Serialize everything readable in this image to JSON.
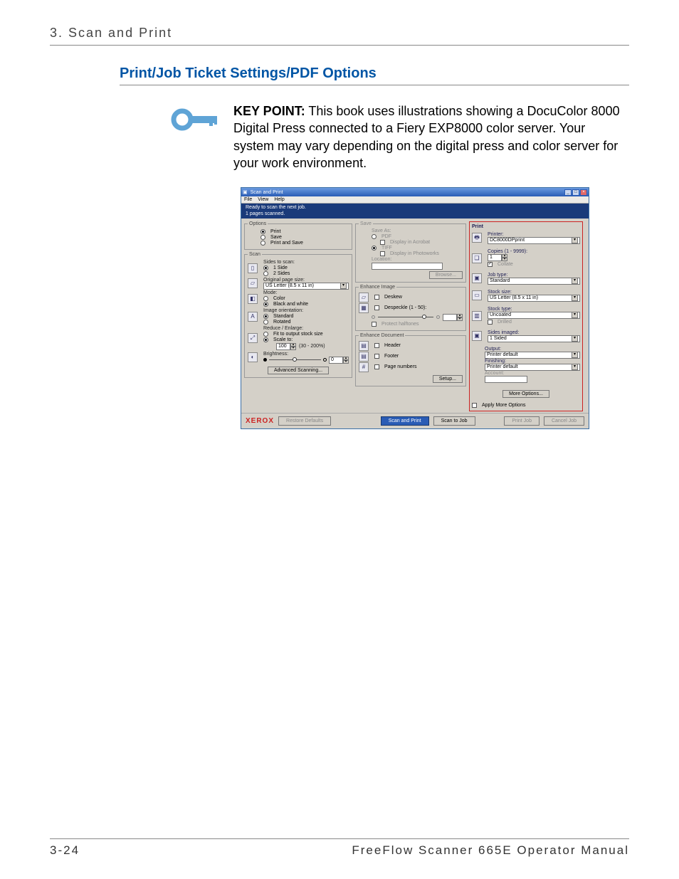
{
  "header": {
    "running": "3. Scan and Print"
  },
  "section": {
    "title": "Print/Job Ticket Settings/PDF Options"
  },
  "keypoint": {
    "label": "KEY POINT:",
    "text": " This book uses illustrations showing a DocuColor 8000 Digital Press connected to a Fiery EXP8000 color server.  Your system may vary depending on the digital press and color server for your work environment."
  },
  "app": {
    "title": "Scan and Print",
    "menu": {
      "file": "File",
      "view": "View",
      "help": "Help"
    },
    "status1": "Ready to scan the next job.",
    "status2": "1 pages scanned.",
    "options": {
      "legend": "Options",
      "print": "Print",
      "save": "Save",
      "printsave": "Print and Save"
    },
    "scan": {
      "legend": "Scan",
      "sides_label": "Sides to scan:",
      "side1": "1 Side",
      "side2": "2 Sides",
      "orig_label": "Original page size:",
      "orig_val": "US Letter (8.5 x 11 in)",
      "mode_label": "Mode:",
      "mode_color": "Color",
      "mode_bw": "Black and white",
      "orient_label": "Image orientation:",
      "orient_std": "Standard",
      "orient_rot": "Rotated",
      "reduce_label": "Reduce / Enlarge:",
      "reduce_fit": "Fit to output stock size",
      "reduce_scale": "Scale to:",
      "scale_val": "100",
      "scale_range": "(30 - 200%)",
      "bright_label": "Brightness:",
      "bright_val": "0",
      "adv": "Advanced Scanning..."
    },
    "savep": {
      "legend": "Save",
      "saveas": "Save As:",
      "pdf": "PDF",
      "disp_acro": "Display in Acrobat",
      "tiff": "TIFF",
      "disp_photo": "Display in Photoworks",
      "loc_label": "Location:",
      "browse": "Browse..."
    },
    "enhimg": {
      "legend": "Enhance Image",
      "deskew": "Deskew",
      "despeckle": "Despeckle (1 - 50):",
      "protect": "Protect halftones"
    },
    "enhdoc": {
      "legend": "Enhance Document",
      "header": "Header",
      "footer": "Footer",
      "pagenum": "Page numbers",
      "setup": "Setup..."
    },
    "print": {
      "legend": "Print",
      "printer_label": "Printer:",
      "printer_val": "DC8000DPprint",
      "copies_label": "Copies (1 - 9999):",
      "copies_val": "1",
      "collate": "Collate",
      "jobtype_label": "Job type:",
      "jobtype_val": "Standard",
      "stocksize_label": "Stock size:",
      "stocksize_val": "US Letter (8.5 x 11 in)",
      "stocktype_label": "Stock type:",
      "stocktype_val": "Uncoated",
      "drilled": "Drilled",
      "sides_label": "Sides imaged:",
      "sides_val": "1 Sided",
      "output_label": "Output:",
      "output_val": "Printer default",
      "finish_label": "Finishing:",
      "finish_val": "Printer default",
      "account_label": "Account:",
      "more": "More Options...",
      "apply": "Apply More Options"
    },
    "footer": {
      "brand": "XEROX",
      "restore": "Restore Defaults",
      "scanprint": "Scan and Print",
      "scantojob": "Scan to Job",
      "printjob": "Print Job",
      "cancel": "Cancel Job"
    }
  },
  "pagefoot": {
    "num": "3-24",
    "book": "FreeFlow Scanner 665E Operator Manual"
  }
}
